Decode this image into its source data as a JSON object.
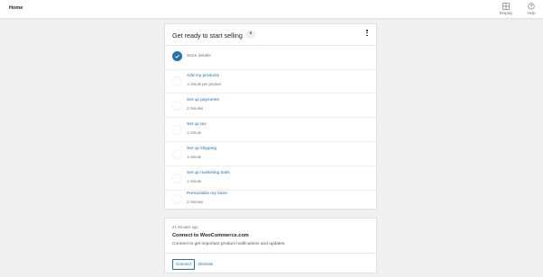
{
  "header": {
    "title": "Home",
    "actions": [
      {
        "label": "Display",
        "icon": "display-icon"
      },
      {
        "label": "Help",
        "icon": "help-icon"
      }
    ]
  },
  "task_list": {
    "title": "Get ready to start selling",
    "count": "6",
    "tasks": [
      {
        "title": "Store details",
        "time": "",
        "completed": true
      },
      {
        "title": "Add my products",
        "time": "1 minute per product",
        "completed": false
      },
      {
        "title": "Set up payments",
        "time": "2 minutes",
        "completed": false
      },
      {
        "title": "Set up tax",
        "time": "1 minute",
        "completed": false
      },
      {
        "title": "Set up shipping",
        "time": "1 minute",
        "completed": false
      },
      {
        "title": "Set up marketing tools",
        "time": "1 minute",
        "completed": false
      },
      {
        "title": "Personalize my store",
        "time": "2 minutes",
        "completed": false
      }
    ]
  },
  "inbox": {
    "time": "21 minutes ago",
    "title": "Connect to WooCommerce.com",
    "body": "Connect to get important product notifications and updates.",
    "primary_label": "Connect",
    "secondary_label": "Dismiss"
  },
  "colors": {
    "accent": "#2271b1",
    "background": "#f0f0f1",
    "muted_text": "#757575"
  }
}
